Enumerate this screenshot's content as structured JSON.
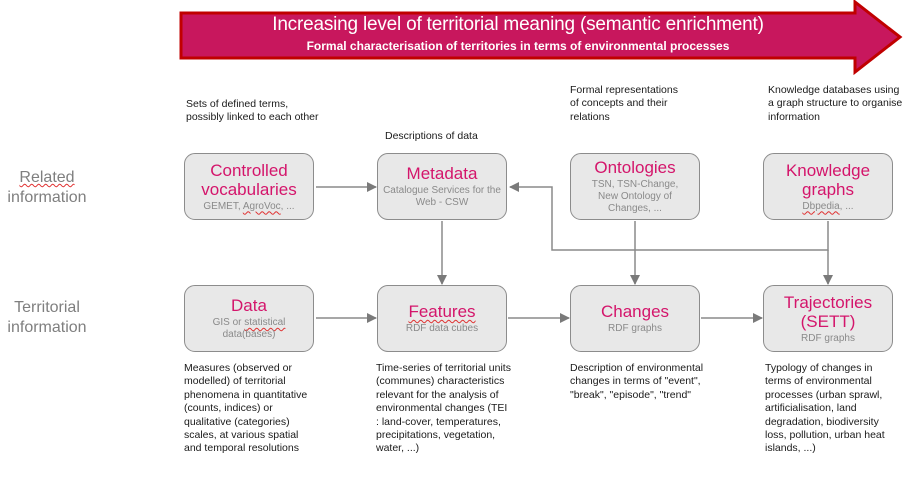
{
  "banner": {
    "title": "Increasing level of territorial meaning (semantic enrichment)",
    "subtitle": "Formal characterisation of territories in terms of environmental processes",
    "fill_color": "#c8175d",
    "border_color": "#c00000"
  },
  "rows": {
    "related": {
      "label_line1": "Related",
      "label_line2": "information"
    },
    "territorial": {
      "label_line1": "Territorial",
      "label_line2": "information"
    }
  },
  "top_row": [
    {
      "id": "controlled-vocabularies",
      "title_line1": "Controlled",
      "title_line2": "vocabularies",
      "subtitle": "GEMET, AgroVoc, ...",
      "description": "Sets of defined terms, possibly linked to each other"
    },
    {
      "id": "metadata",
      "title_line1": "Metadata",
      "subtitle": "Catalogue Services for the Web - CSW",
      "description": "Descriptions of data"
    },
    {
      "id": "ontologies",
      "title_line1": "Ontologies",
      "subtitle": "TSN, TSN-Change, New Ontology of Changes, ...",
      "description": "Formal representations of concepts and their relations"
    },
    {
      "id": "knowledge-graphs",
      "title_line1": "Knowledge",
      "title_line2": "graphs",
      "subtitle": "Dbpedia, ...",
      "description": "Knowledge databases using a graph structure to organise information"
    }
  ],
  "bottom_row": [
    {
      "id": "data",
      "title_line1": "Data",
      "subtitle": "GIS or statistical data(bases)",
      "description": "Measures (observed or modelled) of territorial phenomena in quantitative (counts, indices) or qualitative (categories) scales, at various spatial and temporal resolutions"
    },
    {
      "id": "features",
      "title_line1": "Features",
      "subtitle": "RDF data cubes",
      "description": "Time-series of territorial units (communes) characteristics relevant for the analysis of environmental changes (TEI : land-cover, temperatures, precipitations, vegetation, water, ...)"
    },
    {
      "id": "changes",
      "title_line1": "Changes",
      "subtitle": "RDF graphs",
      "description": "Description of environmental changes in terms of \"event\", \"break\", \"episode\", \"trend\""
    },
    {
      "id": "trajectories",
      "title_line1": "Trajectories",
      "title_line2": "(SETT)",
      "subtitle": "RDF graphs",
      "description": "Typology of changes in terms of environmental processes (urban sprawl, artificialisation, land degradation, biodiversity loss, pollution, urban heat islands, ...)"
    }
  ],
  "edges": [
    {
      "from": "controlled-vocabularies",
      "to": "metadata"
    },
    {
      "from": "knowledge-graphs",
      "to": "metadata"
    },
    {
      "from": "metadata",
      "to": "features"
    },
    {
      "from": "ontologies",
      "to": "changes"
    },
    {
      "from": "knowledge-graphs",
      "to": "trajectories"
    },
    {
      "from": "data",
      "to": "features"
    },
    {
      "from": "features",
      "to": "changes"
    },
    {
      "from": "changes",
      "to": "trajectories"
    }
  ],
  "colors": {
    "title_text": "#d4156b",
    "box_fill": "#e8e8e8",
    "box_border": "#8c8c8c",
    "connector": "#808080",
    "row_label": "#7f7f7f"
  }
}
